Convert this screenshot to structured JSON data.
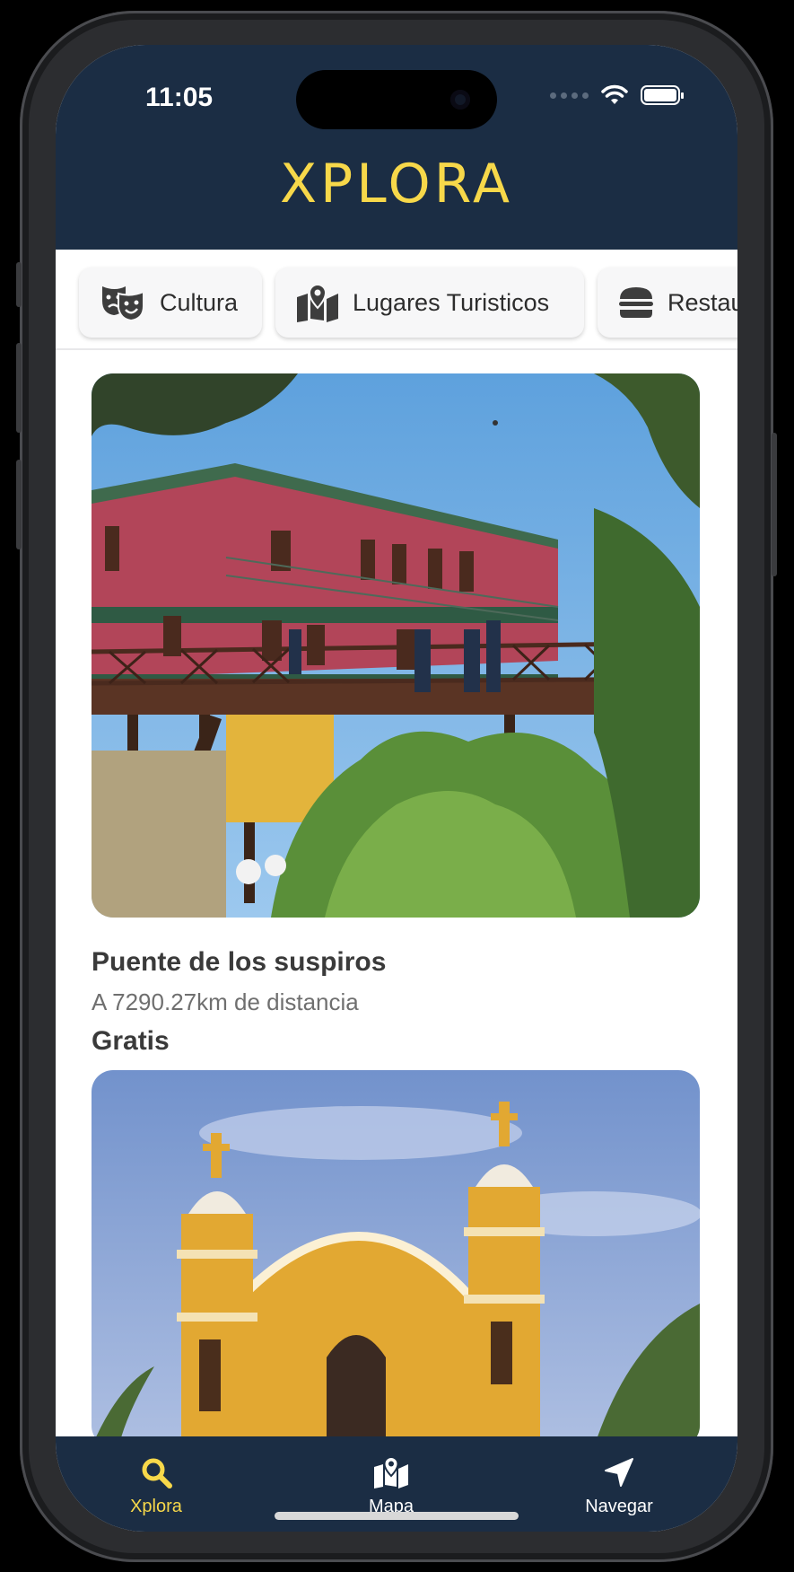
{
  "status_bar": {
    "time": "11:05"
  },
  "header": {
    "title": "XPLORA"
  },
  "categories": [
    {
      "label": "Cultura",
      "icon": "theater-masks-icon"
    },
    {
      "label": "Lugares Turisticos",
      "icon": "map-marker-icon"
    },
    {
      "label": "Restaurantes",
      "icon": "burger-icon"
    }
  ],
  "places": [
    {
      "name": "Puente de los suspiros",
      "distance": "A 7290.27km de distancia",
      "price": "Gratis"
    }
  ],
  "tabs": [
    {
      "label": "Xplora",
      "icon": "search-icon",
      "active": true
    },
    {
      "label": "Mapa",
      "icon": "map-icon",
      "active": false
    },
    {
      "label": "Navegar",
      "icon": "location-arrow-icon",
      "active": false
    }
  ],
  "colors": {
    "brand_dark": "#1b2d44",
    "accent_yellow": "#f7d84a",
    "text_dark": "#3a3a3a",
    "text_muted": "#6f6f6f"
  }
}
